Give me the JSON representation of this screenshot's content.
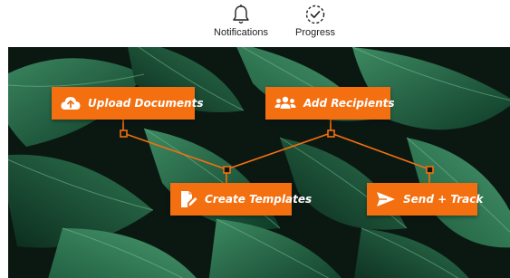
{
  "header": {
    "nav": [
      {
        "label": "Notifications",
        "icon": "bell-icon"
      },
      {
        "label": "Progress",
        "icon": "progress-check-icon"
      }
    ]
  },
  "hero": {
    "background": "dark-green-tropical-leaves",
    "steps": [
      {
        "label": "Upload Documents",
        "icon": "cloud-upload-icon"
      },
      {
        "label": "Add Recipients",
        "icon": "users-icon"
      },
      {
        "label": "Create Templates",
        "icon": "template-edit-icon"
      },
      {
        "label": "Send + Track",
        "icon": "send-icon"
      }
    ]
  },
  "colors": {
    "accent": "#f36f10",
    "connector": "#f36f10",
    "text_on_accent": "#ffffff"
  }
}
